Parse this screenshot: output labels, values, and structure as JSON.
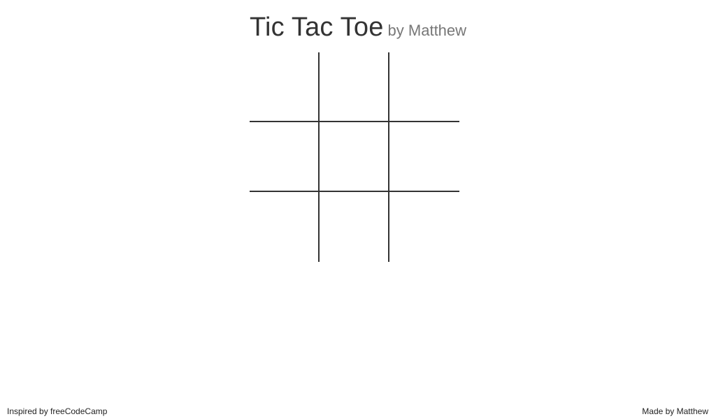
{
  "header": {
    "title": "Tic Tac Toe",
    "subtitle": "by Matthew"
  },
  "board": {
    "cells": [
      "",
      "",
      "",
      "",
      "",
      "",
      "",
      "",
      ""
    ]
  },
  "footer": {
    "left_text": "Inspired by freeCodeCamp",
    "right_text": "Made by Matthew"
  },
  "colors": {
    "text": "#333333",
    "subtitle": "#777777",
    "grid_line": "#333333",
    "background": "#ffffff"
  }
}
